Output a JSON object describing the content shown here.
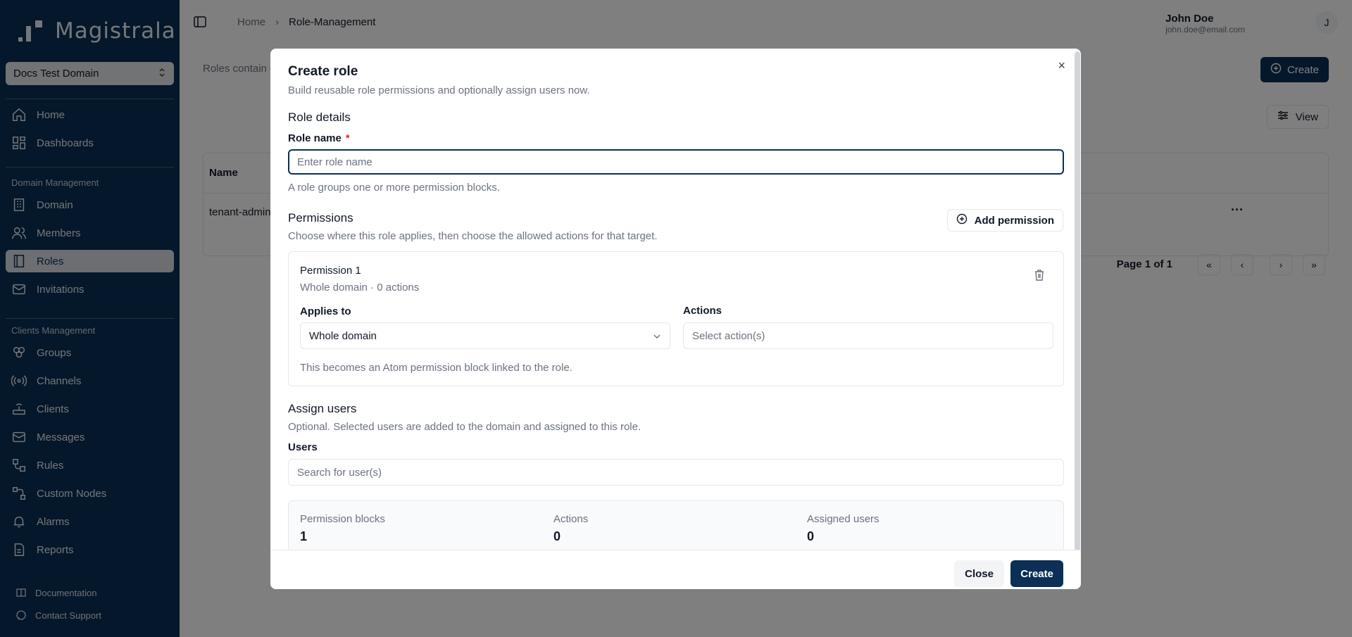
{
  "app": {
    "brand": "Magistrala",
    "domain_select": "Docs Test Domain"
  },
  "sidebar": {
    "items_top": [
      {
        "label": "Home",
        "icon": "home-icon"
      },
      {
        "label": "Dashboards",
        "icon": "dashboard-icon"
      }
    ],
    "section_domain": "Domain Management",
    "items_domain": [
      {
        "label": "Domain",
        "icon": "building-icon"
      },
      {
        "label": "Members",
        "icon": "users-icon"
      },
      {
        "label": "Roles",
        "icon": "book-icon",
        "active": true
      },
      {
        "label": "Invitations",
        "icon": "mail-icon"
      }
    ],
    "section_clients": "Clients Management",
    "items_clients": [
      {
        "label": "Groups",
        "icon": "groups-icon"
      },
      {
        "label": "Channels",
        "icon": "radio-icon"
      },
      {
        "label": "Clients",
        "icon": "router-icon"
      },
      {
        "label": "Messages",
        "icon": "messages-icon"
      },
      {
        "label": "Rules",
        "icon": "workflow-icon"
      },
      {
        "label": "Custom Nodes",
        "icon": "nodes-icon"
      },
      {
        "label": "Alarms",
        "icon": "alarm-icon"
      },
      {
        "label": "Reports",
        "icon": "report-icon"
      }
    ],
    "footer_links": [
      {
        "label": "Documentation",
        "icon": "docs-icon"
      },
      {
        "label": "Contact Support",
        "icon": "chat-icon"
      }
    ]
  },
  "header": {
    "breadcrumb": [
      "Home",
      "Role-Management"
    ],
    "user_name": "John Doe",
    "user_email": "john.doe@email.com",
    "avatar_initial": "J"
  },
  "page": {
    "description_prefix": "Roles contain c",
    "create_label": "Create",
    "view_label": "View",
    "table_header_name": "Name",
    "row_name": "tenant-admin",
    "row_menu": "···",
    "pager_text": "Page 1 of 1",
    "pager_first": "«",
    "pager_prev": "‹",
    "pager_next": "›",
    "pager_last": "»"
  },
  "modal": {
    "title": "Create role",
    "subtitle": "Build reusable role permissions and optionally assign users now.",
    "close_x": "×",
    "role_details_title": "Role details",
    "role_name_label": "Role name",
    "role_name_required": "*",
    "role_name_placeholder": "Enter role name",
    "role_name_value": "",
    "role_name_help": "A role groups one or more permission blocks.",
    "permissions_title": "Permissions",
    "permissions_desc": "Choose where this role applies, then choose the allowed actions for that target.",
    "add_permission_label": "Add permission",
    "permission": {
      "title": "Permission 1",
      "summary": "Whole domain · 0 actions",
      "applies_to_label": "Applies to",
      "applies_to_value": "Whole domain",
      "actions_label": "Actions",
      "actions_placeholder": "Select action(s)",
      "help": "This becomes an Atom permission block linked to the role."
    },
    "assign_title": "Assign users",
    "assign_desc": "Optional. Selected users are added to the domain and assigned to this role.",
    "users_label": "Users",
    "users_placeholder": "Search for user(s)",
    "summary": {
      "blocks_label": "Permission blocks",
      "blocks_value": "1",
      "actions_label": "Actions",
      "actions_value": "0",
      "users_label": "Assigned users",
      "users_value": "0"
    },
    "close_label": "Close",
    "create_label": "Create"
  },
  "colors": {
    "brand": "#0b2f55",
    "required": "#dc2626"
  }
}
